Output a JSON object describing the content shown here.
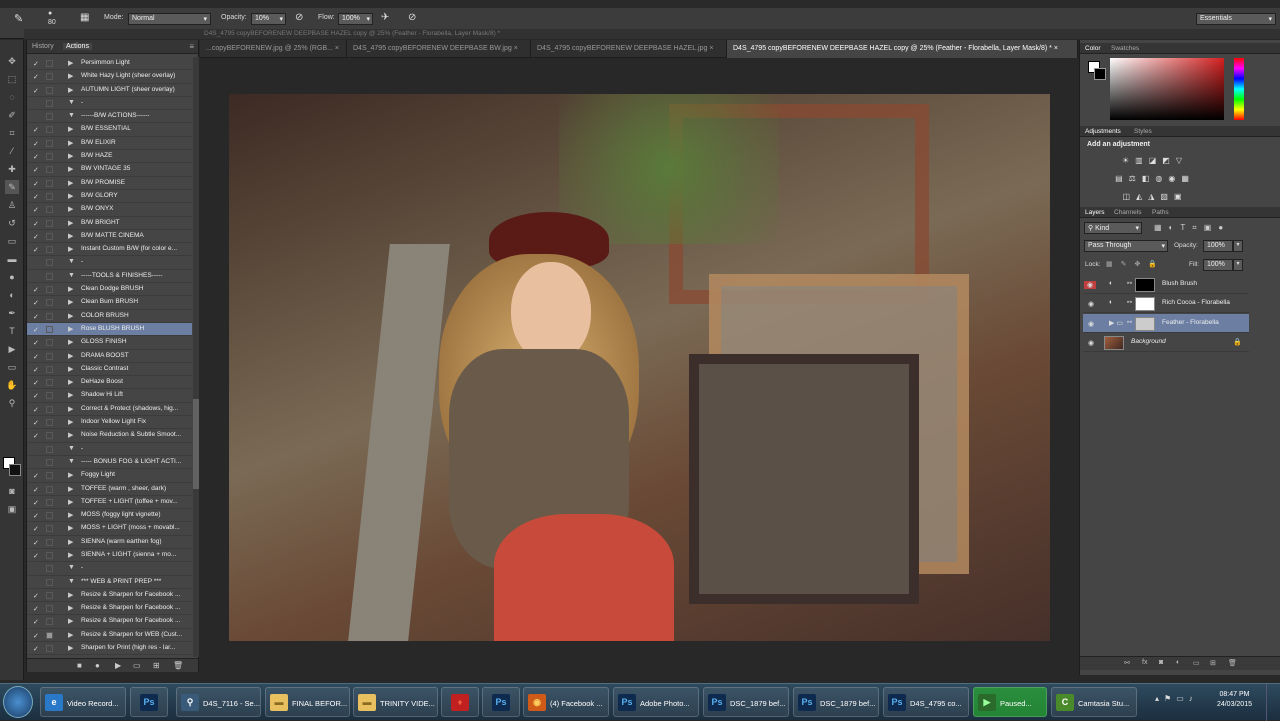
{
  "options_bar": {
    "brush_size": "80",
    "mode_label": "Mode:",
    "mode_value": "Normal",
    "opacity_label": "Opacity:",
    "opacity_value": "10%",
    "flow_label": "Flow:",
    "flow_value": "100%",
    "workspace": "Essentials"
  },
  "title_strip": "D4S_4795 copyBEFORENEW DEEPBASE HAZEL copy @ 25% (Feather - Florabella, Layer Mask/8) *",
  "left_panel": {
    "tabs": [
      "History",
      "Actions"
    ],
    "actions": [
      {
        "label": "Persimmon Light",
        "checked": true,
        "type": "action"
      },
      {
        "label": "White Hazy Light (sheer overlay)",
        "checked": true,
        "type": "action"
      },
      {
        "label": "AUTUMN LIGHT (sheer overlay)",
        "checked": true,
        "type": "action"
      },
      {
        "label": "-",
        "checked": false,
        "type": "set"
      },
      {
        "label": "------B/W ACTIONS------",
        "checked": false,
        "type": "set"
      },
      {
        "label": "B/W ESSENTIAL",
        "checked": true,
        "type": "action"
      },
      {
        "label": "B/W ELIXIR",
        "checked": true,
        "type": "action"
      },
      {
        "label": "B/W HAZE",
        "checked": true,
        "type": "action"
      },
      {
        "label": "BW VINTAGE 35",
        "checked": true,
        "type": "action"
      },
      {
        "label": "B/W PROMISE",
        "checked": true,
        "type": "action"
      },
      {
        "label": "B/W GLORY",
        "checked": true,
        "type": "action"
      },
      {
        "label": "B/W ONYX",
        "checked": true,
        "type": "action"
      },
      {
        "label": "B/W BRIGHT",
        "checked": true,
        "type": "action"
      },
      {
        "label": "B/W MATTE CINEMA",
        "checked": true,
        "type": "action"
      },
      {
        "label": "Instant Custom B/W (for color e...",
        "checked": true,
        "type": "action"
      },
      {
        "label": "-",
        "checked": false,
        "type": "set"
      },
      {
        "label": "-----TOOLS & FINISHES-----",
        "checked": false,
        "type": "set"
      },
      {
        "label": "Clean Dodge BRUSH",
        "checked": true,
        "type": "action"
      },
      {
        "label": "Clean Burn BRUSH",
        "checked": true,
        "type": "action"
      },
      {
        "label": "COLOR BRUSH",
        "checked": true,
        "type": "action"
      },
      {
        "label": "Rose BLUSH BRUSH",
        "checked": true,
        "type": "action",
        "selected": true
      },
      {
        "label": "GLOSS FINISH",
        "checked": true,
        "type": "action"
      },
      {
        "label": "DRAMA BOOST",
        "checked": true,
        "type": "action"
      },
      {
        "label": "Classic Contrast",
        "checked": true,
        "type": "action"
      },
      {
        "label": "DeHaze Boost",
        "checked": true,
        "type": "action"
      },
      {
        "label": "Shadow Hi Lift",
        "checked": true,
        "type": "action"
      },
      {
        "label": "Correct & Protect (shadows, hig...",
        "checked": true,
        "type": "action"
      },
      {
        "label": "Indoor Yellow Light Fix",
        "checked": true,
        "type": "action"
      },
      {
        "label": "Noise Reduction & Subtle Smoot...",
        "checked": true,
        "type": "action"
      },
      {
        "label": "-",
        "checked": false,
        "type": "set"
      },
      {
        "label": "----- BONUS FOG & LIGHT ACTI...",
        "checked": false,
        "type": "set"
      },
      {
        "label": "Foggy Light",
        "checked": true,
        "type": "action"
      },
      {
        "label": "TOFFEE (warm , sheer, dark)",
        "checked": true,
        "type": "action"
      },
      {
        "label": "TOFFEE + LIGHT (toffee + mov...",
        "checked": true,
        "type": "action"
      },
      {
        "label": "MOSS (foggy light vignette)",
        "checked": true,
        "type": "action"
      },
      {
        "label": "MOSS + LIGHT (moss + movabl...",
        "checked": true,
        "type": "action"
      },
      {
        "label": "SIENNA (warm earthen fog)",
        "checked": true,
        "type": "action"
      },
      {
        "label": "SIENNA + LIGHT (sienna + mo...",
        "checked": true,
        "type": "action"
      },
      {
        "label": "-",
        "checked": false,
        "type": "set"
      },
      {
        "label": "*** WEB & PRINT PREP ***",
        "checked": false,
        "type": "set"
      },
      {
        "label": "Resize & Sharpen for Facebook ...",
        "checked": true,
        "type": "action"
      },
      {
        "label": "Resize & Sharpen for Facebook ...",
        "checked": true,
        "type": "action"
      },
      {
        "label": "Resize & Sharpen for Facebook ...",
        "checked": true,
        "type": "action"
      },
      {
        "label": "Resize & Sharpen for WEB (Cust...",
        "checked": true,
        "type": "action",
        "dialog": true
      },
      {
        "label": "Sharpen for Print (high res - lar...",
        "checked": true,
        "type": "action"
      }
    ]
  },
  "doc_tabs": [
    {
      "label": "...copyBEFORENEW.jpg @ 25% (RGB...",
      "active": false
    },
    {
      "label": "D4S_4795 copyBEFORENEW DEEPBASE BW.jpg",
      "active": false
    },
    {
      "label": "D4S_4795 copyBEFORENEW DEEPBASE HAZEL.jpg",
      "active": false
    },
    {
      "label": "D4S_4795 copyBEFORENEW DEEPBASE HAZEL copy @ 25% (Feather - Florabella, Layer Mask/8) *",
      "active": true
    }
  ],
  "right_panel": {
    "color_tabs": [
      "Color",
      "Swatches"
    ],
    "adjust_tabs": [
      "Adjustments",
      "Styles"
    ],
    "add_adjustment": "Add an adjustment",
    "layer_tabs": [
      "Layers",
      "Channels",
      "Paths"
    ],
    "kind": "Kind",
    "blend_mode": "Pass Through",
    "opacity_label": "Opacity:",
    "opacity_value": "100%",
    "lock_label": "Lock:",
    "fill_label": "Fill:",
    "fill_value": "100%",
    "layers": [
      {
        "name": "Blush Brush",
        "selected": false,
        "eye_red": true
      },
      {
        "name": "Rich Cocoa - Florabella",
        "selected": false,
        "eye_red": false
      },
      {
        "name": "Feather - Florabella",
        "selected": true,
        "eye_red": false
      },
      {
        "name": "Background",
        "selected": false,
        "eye_red": false
      }
    ]
  },
  "taskbar": {
    "items": [
      {
        "label": "Video Record...",
        "icon": "ie-icon"
      },
      {
        "label": "",
        "icon": "photoshop-icon"
      },
      {
        "label": "D4S_7116 - Se...",
        "icon": "search-icon"
      },
      {
        "label": "FINAL BEFOR...",
        "icon": "folder-icon"
      },
      {
        "label": "TRINITY VIDE...",
        "icon": "folder-icon"
      },
      {
        "label": "",
        "icon": "flame-icon"
      },
      {
        "label": "",
        "icon": "photoshop-icon"
      },
      {
        "label": "(4) Facebook ...",
        "icon": "firefox-icon"
      },
      {
        "label": "Adobe Photo...",
        "icon": "photoshop-icon"
      },
      {
        "label": "DSC_1879 bef...",
        "icon": "photoshop-icon"
      },
      {
        "label": "DSC_1879 bef...",
        "icon": "photoshop-icon"
      },
      {
        "label": "D4S_4795 co...",
        "icon": "photoshop-icon"
      },
      {
        "label": "Paused...",
        "icon": "recorder-icon"
      },
      {
        "label": "Camtasia Stu...",
        "icon": "camtasia-icon"
      }
    ],
    "time": "08:47 PM",
    "date": "24/03/2015"
  }
}
